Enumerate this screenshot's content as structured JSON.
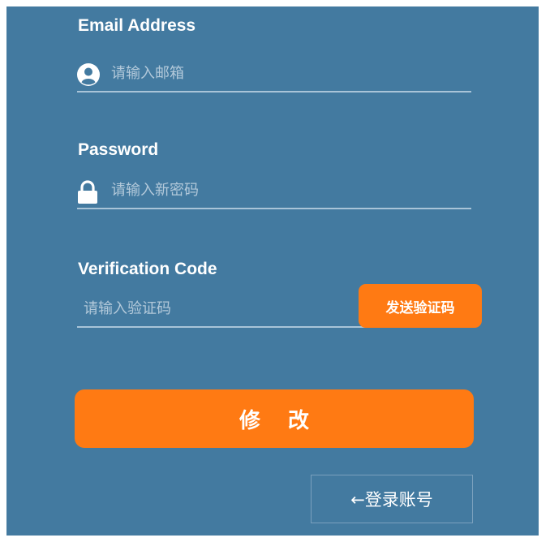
{
  "form": {
    "email": {
      "label": "Email Address",
      "placeholder": "请输入邮箱",
      "icon": "user-icon"
    },
    "password": {
      "label": "Password",
      "placeholder": "请输入新密码",
      "icon": "lock-icon"
    },
    "code": {
      "label": "Verification Code",
      "placeholder": "请输入验证码",
      "send_label": "发送验证码"
    },
    "submit_label": "修改",
    "login_link_label": "←登录账号"
  },
  "colors": {
    "panel_bg": "#437aa0",
    "accent": "#ff7a13",
    "text": "#ffffff",
    "underline": "#a9c4d8"
  }
}
